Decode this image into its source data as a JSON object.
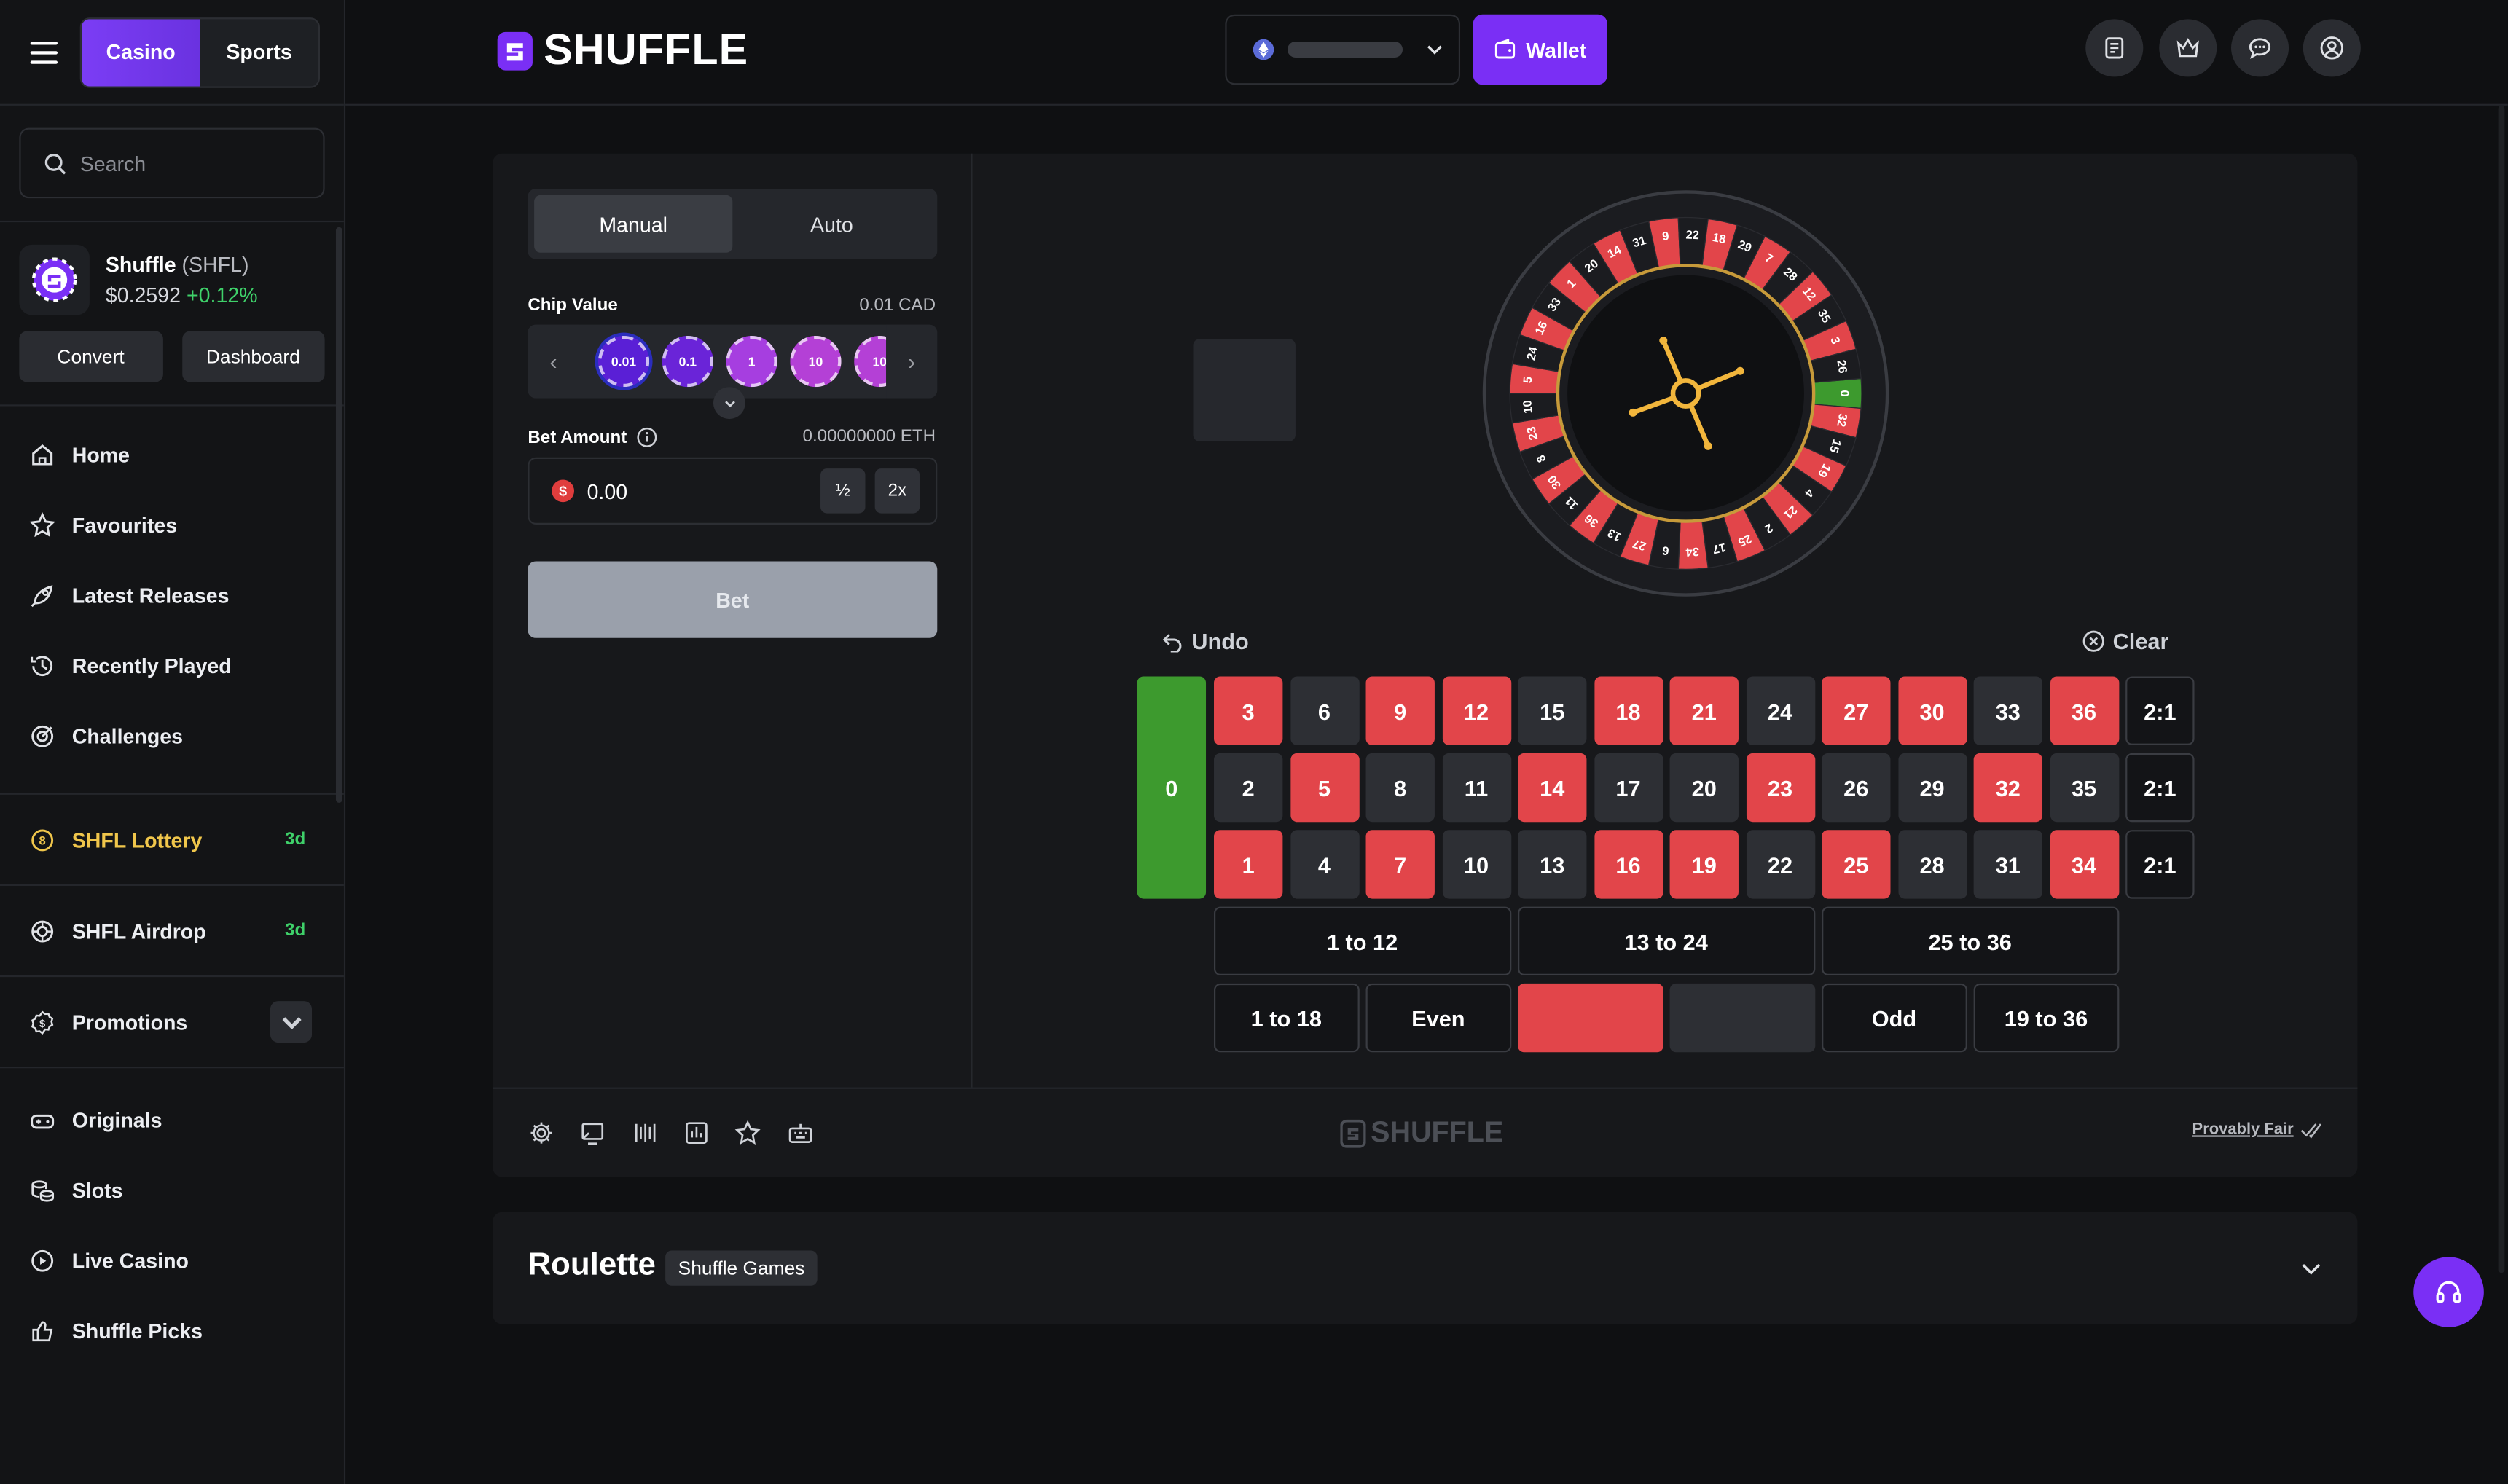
{
  "sidebar": {
    "tabs": {
      "casino": "Casino",
      "sports": "Sports"
    },
    "search_placeholder": "Search",
    "token": {
      "name": "Shuffle",
      "symbol": "(SHFL)",
      "price": "$0.2592",
      "change": "+0.12%"
    },
    "convert": "Convert",
    "dashboard": "Dashboard",
    "nav": [
      {
        "label": "Home",
        "icon": "home-icon"
      },
      {
        "label": "Favourites",
        "icon": "star-icon"
      },
      {
        "label": "Latest Releases",
        "icon": "rocket-icon"
      },
      {
        "label": "Recently Played",
        "icon": "history-icon"
      },
      {
        "label": "Challenges",
        "icon": "target-icon"
      }
    ],
    "lottery": {
      "label": "SHFL Lottery",
      "badge": "3d"
    },
    "airdrop": {
      "label": "SHFL Airdrop",
      "badge": "3d"
    },
    "promotions": "Promotions",
    "games": [
      {
        "label": "Originals"
      },
      {
        "label": "Slots"
      },
      {
        "label": "Live Casino"
      },
      {
        "label": "Shuffle Picks"
      }
    ]
  },
  "topbar": {
    "logo": "SHUFFLE",
    "wallet": "Wallet"
  },
  "controls": {
    "manual": "Manual",
    "auto": "Auto",
    "chip_label": "Chip Value",
    "chip_value": "0.01 CAD",
    "chips": [
      "0.01",
      "0.1",
      "1",
      "10",
      "10"
    ],
    "bet_label": "Bet Amount",
    "bet_crypto": "0.00000000 ETH",
    "bet_amount": "0.00",
    "half": "½",
    "double": "2x",
    "bet_button": "Bet"
  },
  "board": {
    "undo": "Undo",
    "clear": "Clear",
    "zero": "0",
    "rows": [
      [
        "3",
        "6",
        "9",
        "12",
        "15",
        "18",
        "21",
        "24",
        "27",
        "30",
        "33",
        "36"
      ],
      [
        "2",
        "5",
        "8",
        "11",
        "14",
        "17",
        "20",
        "23",
        "26",
        "29",
        "32",
        "35"
      ],
      [
        "1",
        "4",
        "7",
        "10",
        "13",
        "16",
        "19",
        "22",
        "25",
        "28",
        "31",
        "34"
      ]
    ],
    "red_numbers": [
      "1",
      "3",
      "5",
      "7",
      "9",
      "12",
      "14",
      "16",
      "18",
      "19",
      "21",
      "23",
      "25",
      "27",
      "30",
      "32",
      "34",
      "36"
    ],
    "column_bet": "2:1",
    "dozens": [
      "1 to 12",
      "13 to 24",
      "25 to 36"
    ],
    "low": "1 to 18",
    "even": "Even",
    "odd": "Odd",
    "high": "19 to 36"
  },
  "wheel": {
    "numbers": [
      "0",
      "32",
      "15",
      "19",
      "4",
      "21",
      "2",
      "25",
      "17",
      "34",
      "6",
      "27",
      "13",
      "36",
      "11",
      "30",
      "8",
      "23",
      "10",
      "5",
      "24",
      "16",
      "33",
      "1",
      "20",
      "14",
      "31",
      "9",
      "22",
      "18",
      "29",
      "7",
      "28",
      "12",
      "35",
      "3",
      "26"
    ]
  },
  "footer": {
    "logo": "SHUFFLE",
    "provably_fair": "Provably Fair"
  },
  "info": {
    "title": "Roulette",
    "provider": "Shuffle Games"
  },
  "colors": {
    "accent": "#7a2ff5",
    "red": "#e2454a",
    "green": "#3d9a2e",
    "gold": "#f0c64b"
  }
}
